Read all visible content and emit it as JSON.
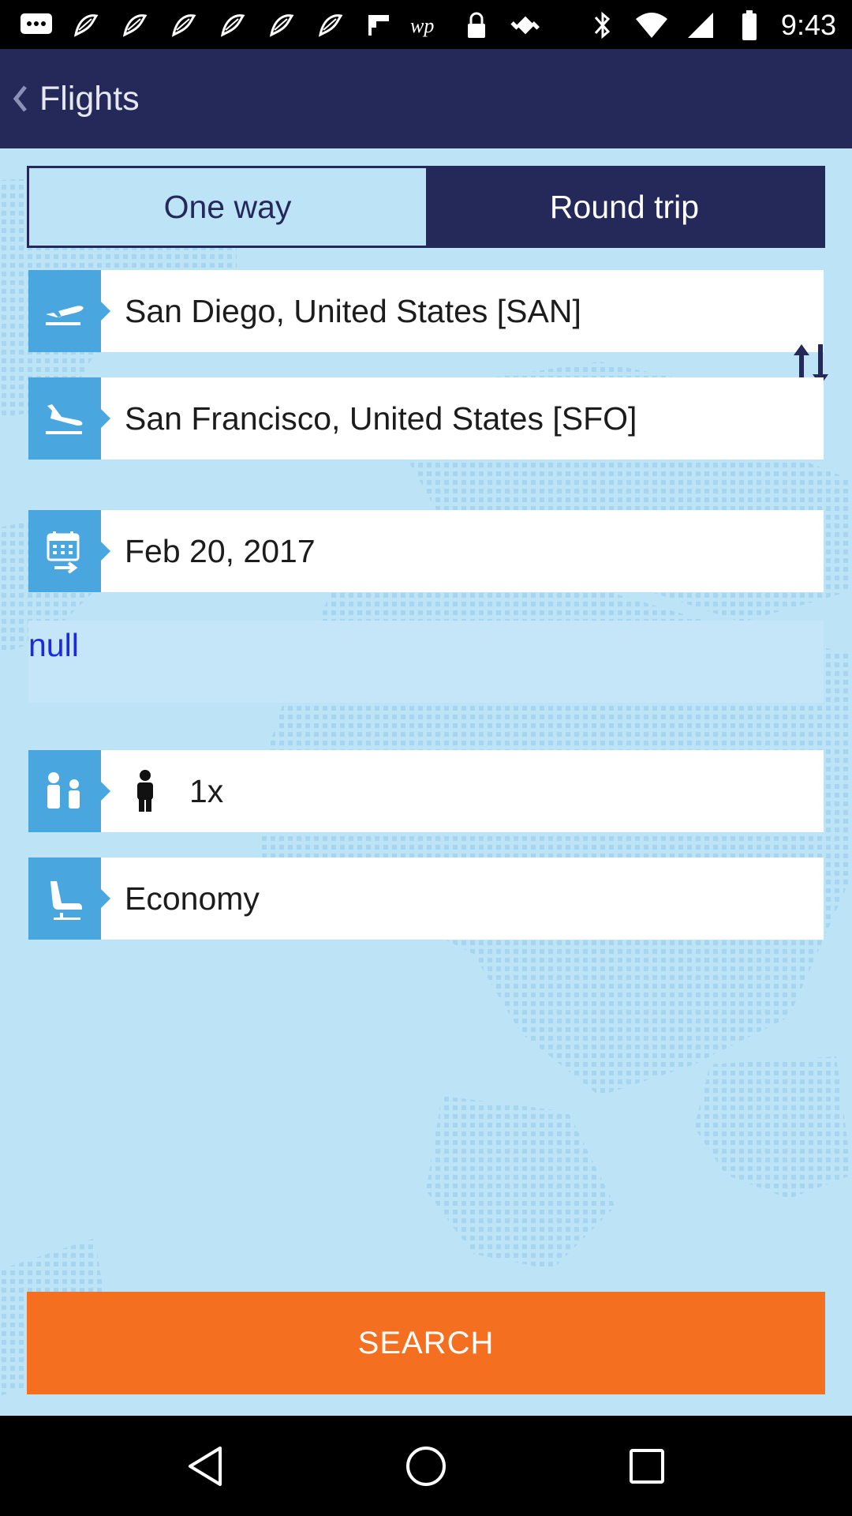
{
  "status_bar": {
    "time": "9:43",
    "left_icons": [
      "chat-icon",
      "signal-feather-icon",
      "signal-feather-icon",
      "signal-feather-icon",
      "signal-feather-icon",
      "signal-feather-icon",
      "signal-feather-icon",
      "flipboard-icon",
      "wp-icon",
      "lock-icon",
      "fake-gps-icon"
    ],
    "right_icons": [
      "bluetooth-icon",
      "wifi-icon",
      "cell-signal-icon",
      "battery-icon"
    ]
  },
  "header": {
    "title": "Flights",
    "background": "#25295a"
  },
  "trip_type": {
    "one_way_label": "One way",
    "round_trip_label": "Round trip",
    "selected": "One way"
  },
  "form": {
    "origin": "San Diego, United States [SAN]",
    "destination": "San Francisco, United States [SFO]",
    "date": "Feb 20, 2017",
    "null_text": "null",
    "passengers": "1x",
    "cabin_class": "Economy",
    "icon_color": "#4aa6df"
  },
  "search": {
    "label": "SEARCH",
    "color": "#f47020"
  },
  "nav_bar": {
    "buttons": [
      "back-triangle-icon",
      "home-circle-icon",
      "recents-square-icon"
    ]
  }
}
